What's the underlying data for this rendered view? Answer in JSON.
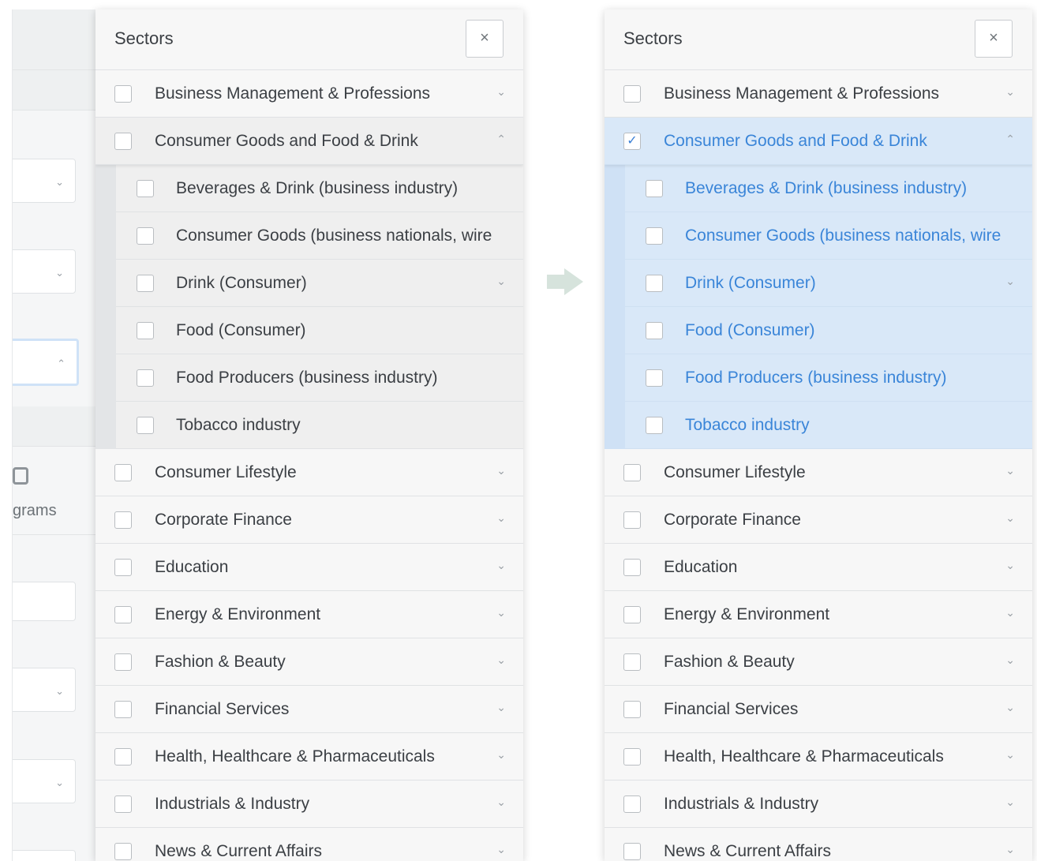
{
  "panel_title": "Sectors",
  "close_label": "×",
  "background_form": {
    "partial_text": "grams"
  },
  "sectors": [
    {
      "label": "Business Management & Professions",
      "chevron": "⌄",
      "expanded": false
    },
    {
      "label": "Consumer Goods and Food & Drink",
      "chevron": "⌃",
      "expanded": true,
      "subsectors": [
        {
          "label": "Beverages & Drink (business industry)",
          "chevron": ""
        },
        {
          "label": "Consumer Goods (business nationals, wire",
          "chevron": ""
        },
        {
          "label": "Drink (Consumer)",
          "chevron": "⌄"
        },
        {
          "label": "Food (Consumer)",
          "chevron": ""
        },
        {
          "label": "Food Producers (business industry)",
          "chevron": ""
        },
        {
          "label": "Tobacco industry",
          "chevron": ""
        }
      ]
    },
    {
      "label": "Consumer Lifestyle",
      "chevron": "⌄"
    },
    {
      "label": "Corporate Finance",
      "chevron": "⌄"
    },
    {
      "label": "Education",
      "chevron": "⌄"
    },
    {
      "label": "Energy & Environment",
      "chevron": "⌄"
    },
    {
      "label": "Fashion & Beauty",
      "chevron": "⌄"
    },
    {
      "label": "Financial Services",
      "chevron": "⌄"
    },
    {
      "label": "Health, Healthcare & Pharmaceuticals",
      "chevron": "⌄"
    },
    {
      "label": "Industrials & Industry",
      "chevron": "⌄"
    },
    {
      "label": "News & Current Affairs",
      "chevron": "⌄"
    }
  ],
  "before_state": {
    "checked_sector": null
  },
  "after_state": {
    "checked_sector": "Consumer Goods and Food & Drink",
    "check_mark": "✓"
  },
  "icons": {
    "close": "close-icon",
    "chevron": "chevron-icon",
    "arrow": "arrow-right-icon",
    "instagram": "instagram-icon"
  },
  "colors": {
    "selected_bg": "#d9e8f8",
    "selected_text": "#3a85d8",
    "arrow": "#d6e3dc"
  }
}
